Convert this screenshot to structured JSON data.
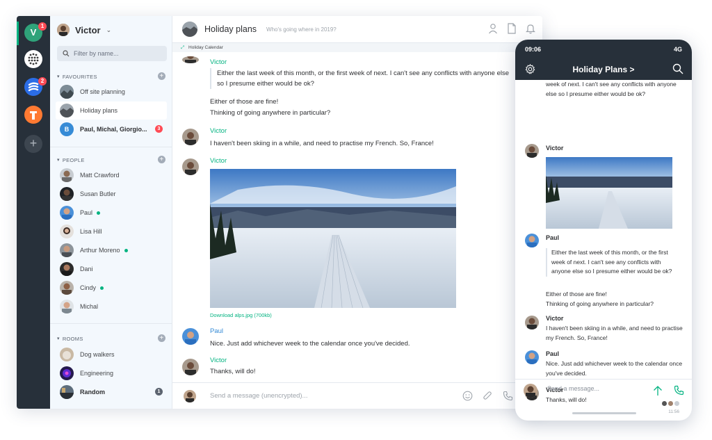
{
  "rail": {
    "home_initial": "V",
    "home_badge": "1",
    "community_badge": "2",
    "add_label": "+"
  },
  "user": {
    "name": "Victor"
  },
  "filter": {
    "placeholder": "Filter by name..."
  },
  "favourites": {
    "heading": "FAVOURITES",
    "items": [
      {
        "label": "Off site planning"
      },
      {
        "label": "Holiday plans"
      },
      {
        "label": "Paul, Michal, Giorgio...",
        "initial": "B",
        "badge": "3"
      }
    ]
  },
  "people": {
    "heading": "PEOPLE",
    "items": [
      {
        "label": "Matt Crawford"
      },
      {
        "label": "Susan Butler"
      },
      {
        "label": "Paul"
      },
      {
        "label": "Lisa Hill"
      },
      {
        "label": "Arthur Moreno"
      },
      {
        "label": "Dani"
      },
      {
        "label": "Cindy"
      },
      {
        "label": "Michal"
      }
    ]
  },
  "rooms": {
    "heading": "ROOMS",
    "items": [
      {
        "label": "Dog walkers"
      },
      {
        "label": "Engineering"
      },
      {
        "label": "Random",
        "badge": "1"
      }
    ]
  },
  "chat": {
    "title": "Holiday plans",
    "topic": "Who's going where in 2019?",
    "widget": "Holiday Calendar",
    "messages": {
      "m1_sender": "Victor",
      "m1_quote": "Either the last week of this month, or the first week of next. I can't see any conflicts with anyone else so I presume either would be ok?",
      "m1_line1": "Either of those are fine!",
      "m1_line2": "Thinking of going anywhere in particular?",
      "m2_sender": "Victor",
      "m2_text": "I haven't been skiing in a while, and need to practise my French. So, France!",
      "m3_sender": "Victor",
      "m3_download": "Download alps.jpg (700kb)",
      "m4_sender": "Paul",
      "m4_text": "Nice. Just add whichever week to the calendar once you've decided.",
      "m5_sender": "Victor",
      "m5_text": "Thanks, will do!"
    },
    "composer_placeholder": "Send a message (unencrypted)..."
  },
  "phone": {
    "time": "09:06",
    "network": "4G",
    "title": "Holiday Plans >",
    "top_text": "week of next. I can't see any conflicts with anyone else so I presume either would be ok?",
    "m1_sender": "Victor",
    "m2_sender": "Paul",
    "m2_quote": "Either the last week of this month, or the first week of next. I can't see any conflicts with anyone else so I presume either would be ok?",
    "m2_line1": "Either of those are fine!",
    "m2_line2": "Thinking of going anywhere in particular?",
    "m3_sender": "Victor",
    "m3_text": "I haven't been skiing in a while, and need to practise my French. So, France!",
    "m4_sender": "Paul",
    "m4_text": "Nice. Just add whichever week to the calendar once you've decided.",
    "m5_sender": "Victor",
    "m5_text": "Thanks, will do!",
    "m5_time": "11:56",
    "composer_placeholder": "Send a message..."
  },
  "colors": {
    "accent": "#03b381",
    "rail_bg": "#27303a",
    "sidebar_bg": "#f3f8fd",
    "badge_red": "#ff4b55",
    "paul_blue": "#368bd6"
  }
}
